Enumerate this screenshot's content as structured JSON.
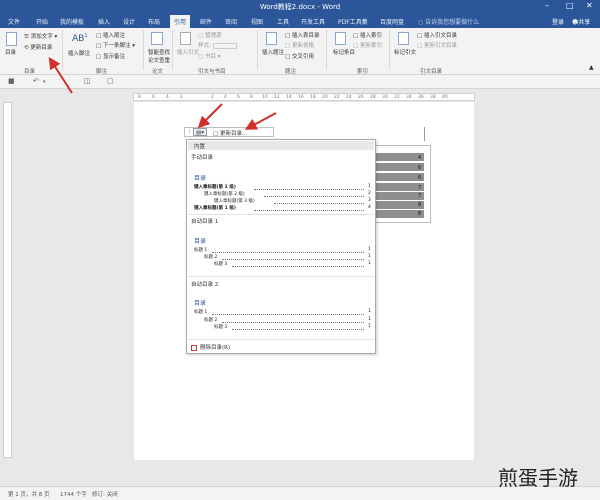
{
  "window": {
    "title": "Word教程2.docx - Word",
    "controls": [
      "–",
      "□",
      "✕"
    ]
  },
  "menubar": {
    "tabs": [
      {
        "label": "文件",
        "active": false
      },
      {
        "label": "开始",
        "active": false
      },
      {
        "label": "我的模板",
        "active": false
      },
      {
        "label": "插入",
        "active": false
      },
      {
        "label": "设计",
        "active": false
      },
      {
        "label": "布局",
        "active": false
      },
      {
        "label": "引用",
        "active": true
      },
      {
        "label": "邮件",
        "active": false
      },
      {
        "label": "审阅",
        "active": false
      },
      {
        "label": "视图",
        "active": false
      },
      {
        "label": "工具",
        "active": false
      },
      {
        "label": "开发工具",
        "active": false
      },
      {
        "label": "PDF工具集",
        "active": false
      },
      {
        "label": "百度网盘",
        "active": false
      }
    ],
    "tell_me": "告诉我您想要做什么",
    "login": "登录",
    "share": "共享"
  },
  "ribbon": {
    "toc": {
      "big_label": "目录",
      "add_text": "添加文字",
      "update": "更新目录",
      "group": "目录"
    },
    "footnote": {
      "insert_footnote": "插入脚注",
      "insert_endnote": "插入尾注",
      "next_footnote": "下一条脚注",
      "show_notes": "显示备注",
      "group": "脚注"
    },
    "research": {
      "smart_lookup": "智能查找",
      "paper_lookup": "论文查重",
      "group": "论文"
    },
    "citation": {
      "insert_citation": "插入引文",
      "manage_sources": "管理源",
      "style": "样式:",
      "bibliography": "书目",
      "group": "引文与书目"
    },
    "caption": {
      "insert_caption": "插入题注",
      "insert_table_figures": "插入表目录",
      "update_table": "更新表格",
      "cross_reference": "交叉引用",
      "group": "题注"
    },
    "index": {
      "mark_entry": "标记条目",
      "insert_index": "插入索引",
      "update_index": "更新索引",
      "group": "索引"
    },
    "authorities": {
      "mark_citation": "标记引文",
      "insert_toa": "插入引文目录",
      "update_toa": "更新引文目录",
      "group": "引文目录"
    }
  },
  "ruler": {
    "ticks": [
      "8",
      "6",
      "4",
      "2",
      "",
      "2",
      "4",
      "6",
      "8",
      "10",
      "12",
      "14",
      "16",
      "18",
      "20",
      "22",
      "24",
      "26",
      "28",
      "30",
      "32",
      "34",
      "36",
      "38",
      "40"
    ]
  },
  "toc_control": {
    "update_button": "更新目录..."
  },
  "dropdown": {
    "header": "内置",
    "manual": {
      "label": "手动目录",
      "title": "目录",
      "entries": [
        {
          "text": "键入章标题(第 1 级)",
          "page": "1",
          "level": 1
        },
        {
          "text": "键入章标题(第 2 级)",
          "page": "2",
          "level": 2
        },
        {
          "text": "键入章标题(第 3 级)",
          "page": "3",
          "level": 3
        },
        {
          "text": "键入章标题(第 1 级)",
          "page": "4",
          "level": 1
        }
      ]
    },
    "auto1": {
      "label": "自动目录 1",
      "title": "目录",
      "entries": [
        {
          "text": "标题 1",
          "page": "1",
          "level": 1
        },
        {
          "text": "标题 2",
          "page": "1",
          "level": 2
        },
        {
          "text": "标题 3",
          "page": "1",
          "level": 3
        }
      ]
    },
    "auto2": {
      "label": "自动目录 2",
      "title": "目录",
      "entries": [
        {
          "text": "标题 1",
          "page": "1",
          "level": 1
        },
        {
          "text": "标题 2",
          "page": "1",
          "level": 2
        },
        {
          "text": "标题 3",
          "page": "1",
          "level": 3
        }
      ]
    },
    "delete": "删除目录(R)"
  },
  "doc_toc_numbers": [
    "4",
    "6",
    "6",
    "7",
    "7",
    "8",
    "8"
  ],
  "statusbar": {
    "page": "第 1 页，共 8 页",
    "words": "1744 个字",
    "mode": "修订: 关闭"
  },
  "watermark": "煎蛋手游",
  "colors": {
    "word_blue": "#2b579a",
    "arrow_red": "#d0302a"
  }
}
